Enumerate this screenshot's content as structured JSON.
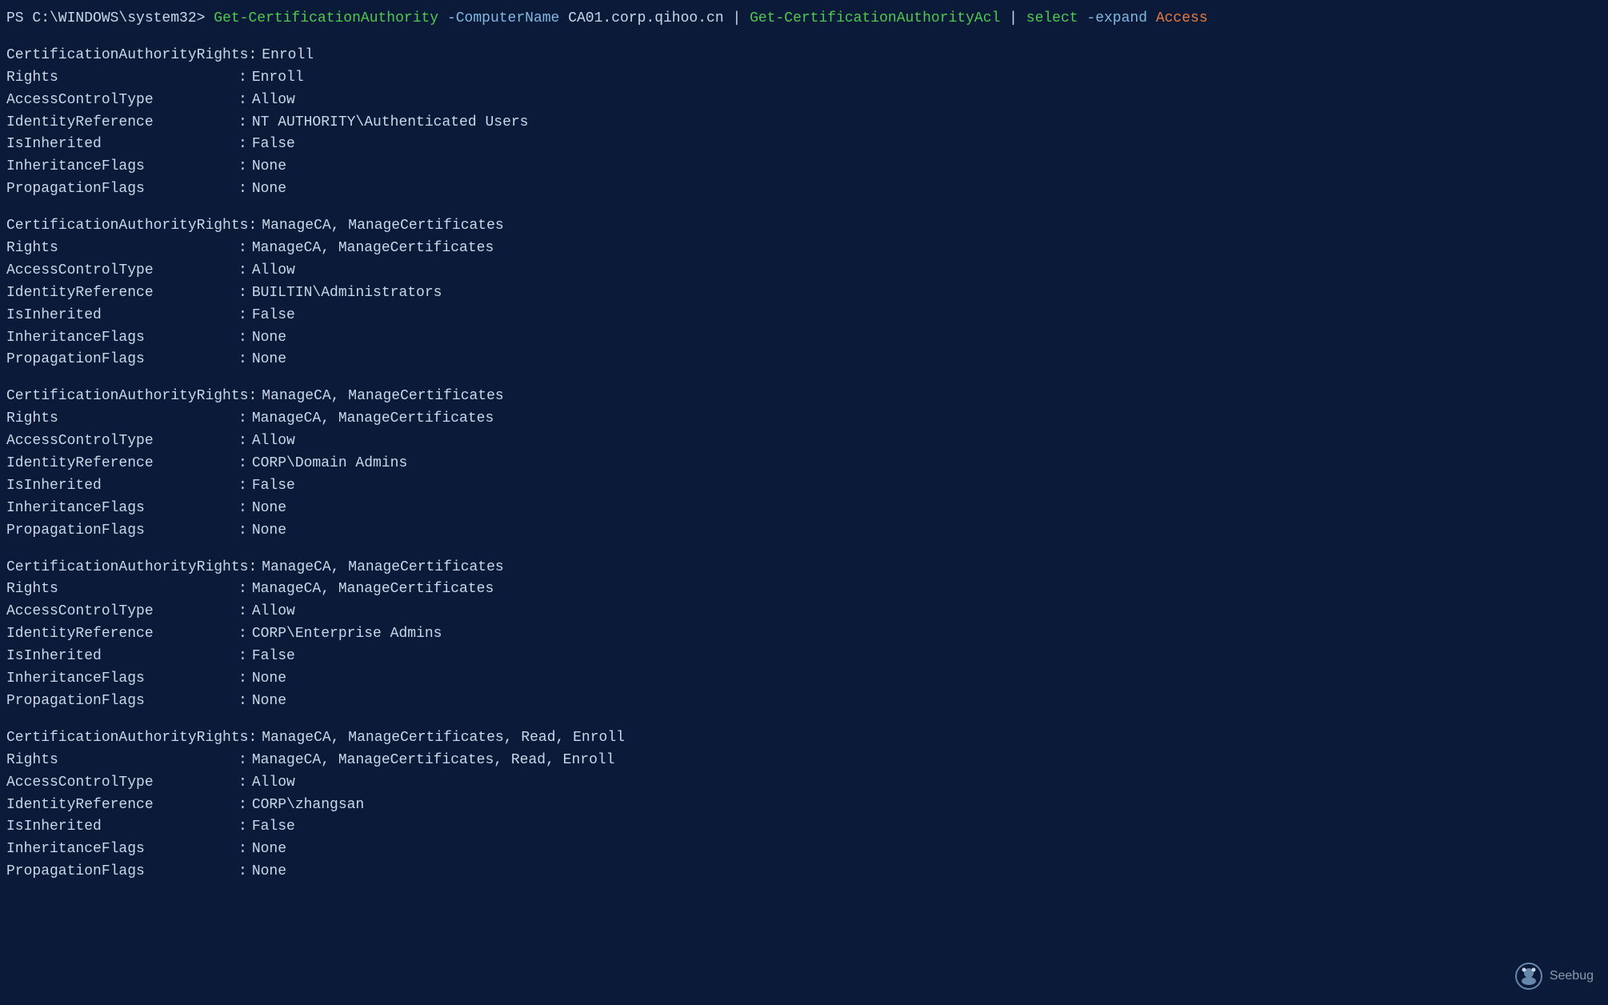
{
  "terminal": {
    "prompt": "PS C:\\WINDOWS\\system32>",
    "command": {
      "part1": "Get-CertificationAuthority",
      "param1": "-ComputerName",
      "value1": "CA01.corp.qihoo.cn",
      "pipe1": "|",
      "part2": "Get-CertificationAuthorityAcl",
      "pipe2": "|",
      "part3": "select",
      "param2": "-expand",
      "keyword": "Access"
    },
    "entries": [
      {
        "CertificationAuthorityRights": "Enroll",
        "Rights": "Enroll",
        "AccessControlType": "Allow",
        "IdentityReference": "NT AUTHORITY\\Authenticated Users",
        "IsInherited": "False",
        "InheritanceFlags": "None",
        "PropagationFlags": "None"
      },
      {
        "CertificationAuthorityRights": "ManageCA, ManageCertificates",
        "Rights": "ManageCA, ManageCertificates",
        "AccessControlType": "Allow",
        "IdentityReference": "BUILTIN\\Administrators",
        "IsInherited": "False",
        "InheritanceFlags": "None",
        "PropagationFlags": "None"
      },
      {
        "CertificationAuthorityRights": "ManageCA, ManageCertificates",
        "Rights": "ManageCA, ManageCertificates",
        "AccessControlType": "Allow",
        "IdentityReference": "CORP\\Domain Admins",
        "IsInherited": "False",
        "InheritanceFlags": "None",
        "PropagationFlags": "None"
      },
      {
        "CertificationAuthorityRights": "ManageCA, ManageCertificates",
        "Rights": "ManageCA, ManageCertificates",
        "AccessControlType": "Allow",
        "IdentityReference": "CORP\\Enterprise Admins",
        "IsInherited": "False",
        "InheritanceFlags": "None",
        "PropagationFlags": "None"
      },
      {
        "CertificationAuthorityRights": "ManageCA, ManageCertificates, Read, Enroll",
        "Rights": "ManageCA, ManageCertificates, Read, Enroll",
        "AccessControlType": "Allow",
        "IdentityReference": "CORP\\zhangsan",
        "IsInherited": "False",
        "InheritanceFlags": "None",
        "PropagationFlags": "None"
      }
    ],
    "watermark": "Seebug"
  }
}
